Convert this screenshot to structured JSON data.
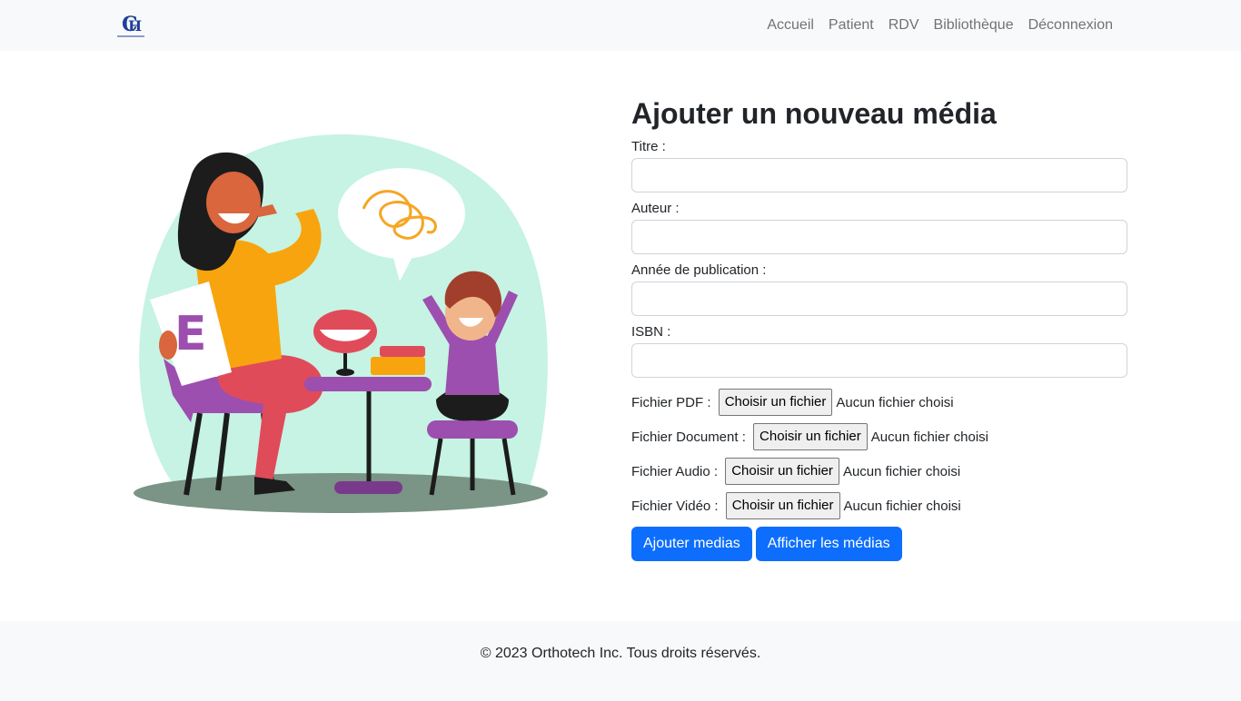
{
  "navbar": {
    "logo_icon": "orthotech-logo-icon",
    "items": [
      {
        "label": "Accueil"
      },
      {
        "label": "Patient"
      },
      {
        "label": "RDV"
      },
      {
        "label": "Bibliothèque"
      },
      {
        "label": "Déconnexion"
      }
    ]
  },
  "illustration": {
    "description_icon": "speech-therapy-illustration",
    "card_letter": "E"
  },
  "form": {
    "title": "Ajouter un nouveau média",
    "fields": [
      {
        "label": "Titre :",
        "value": ""
      },
      {
        "label": "Auteur :",
        "value": ""
      },
      {
        "label": "Année de publication :",
        "value": ""
      },
      {
        "label": "ISBN :",
        "value": ""
      }
    ],
    "files": [
      {
        "label": "Fichier PDF : ",
        "button": "Choisir un fichier",
        "status": "Aucun fichier choisi"
      },
      {
        "label": "Fichier Document : ",
        "button": "Choisir un fichier",
        "status": "Aucun fichier choisi"
      },
      {
        "label": "Fichier Audio : ",
        "button": "Choisir un fichier",
        "status": "Aucun fichier choisi"
      },
      {
        "label": "Fichier Vidéo : ",
        "button": "Choisir un fichier",
        "status": "Aucun fichier choisi"
      }
    ],
    "submit_label": "Ajouter medias",
    "show_label": "Afficher les médias"
  },
  "footer": {
    "copyright": "© 2023 Orthotech Inc. Tous droits réservés."
  },
  "colors": {
    "primary": "#0d6efd",
    "navbar_bg": "#f8f9fa",
    "nav_link": "#737475",
    "illustration_bg": "#c6f3e3"
  }
}
